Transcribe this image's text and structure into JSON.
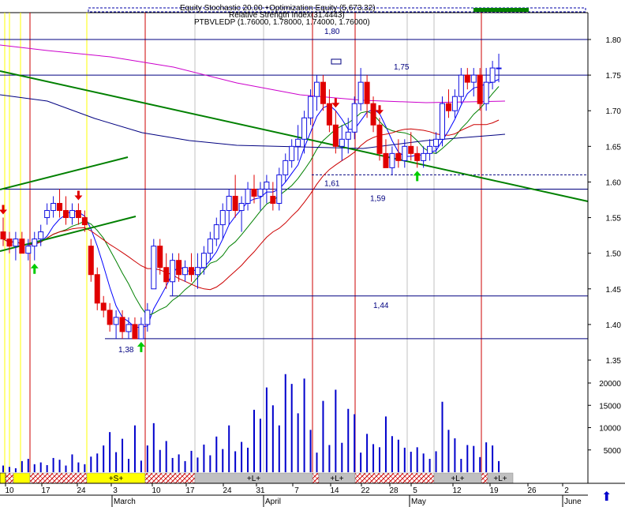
{
  "header": {
    "line1": "Equity Stochastic 20.00 +Optimization Equity (5,673.32)",
    "line2": "Relative Strength Index(31.4443)",
    "line3": "PTBVLEDP (1.76000, 1.78000, 1.74000, 1.76000)"
  },
  "colors": {
    "up_candle": "#1010e0",
    "down_candle": "#e00000",
    "volume": "#0000cc",
    "trendline": "#008000",
    "ma_fast": "#0000ff",
    "ma_mid": "#008000",
    "ma_slow": "#cc0000",
    "ma_long": "#cc00cc",
    "ma_navy": "#000080",
    "marker_line": "#cc0000",
    "band_yellow": "#ffff00",
    "band_gray": "#c0c0c0",
    "band_hatch": "#cc0000"
  },
  "chart_data": {
    "type": "candlestick",
    "price_axis": {
      "min": 1.35,
      "max": 1.8,
      "ticks": [
        "1.80",
        "1.75",
        "1.70",
        "1.65",
        "1.60",
        "1.55",
        "1.50",
        "1.45",
        "1.40",
        "1.35"
      ]
    },
    "volume_axis": {
      "ticks": [
        "20000",
        "15000",
        "10000",
        "5000"
      ]
    },
    "x_ticks": [
      "10",
      "17",
      "24",
      "3",
      "10",
      "17",
      "24",
      "31",
      "7",
      "14",
      "22",
      "28",
      "5",
      "12",
      "19",
      "26",
      "2"
    ],
    "month_labels": [
      "March",
      "April",
      "May",
      "June"
    ],
    "horizontal_levels": [
      {
        "label": "1,80",
        "value": 1.8
      },
      {
        "label": "1,75",
        "value": 1.75
      },
      {
        "label": "1,61",
        "value": 1.61
      },
      {
        "label": "1,59",
        "value": 1.59
      },
      {
        "label": "1,44",
        "value": 1.44
      },
      {
        "label": "1,38",
        "value": 1.38
      }
    ],
    "bands": [
      {
        "label": "",
        "color": "yellow"
      },
      {
        "label": "+S+",
        "color": "yellow"
      },
      {
        "label": "+L+",
        "color": "gray"
      },
      {
        "label": "+L+",
        "color": "gray"
      },
      {
        "label": "+L+",
        "color": "gray"
      },
      {
        "label": "+L+",
        "color": "gray"
      }
    ],
    "candles": [
      {
        "o": 1.53,
        "h": 1.55,
        "l": 1.51,
        "c": 1.52
      },
      {
        "o": 1.52,
        "h": 1.53,
        "l": 1.5,
        "c": 1.51
      },
      {
        "o": 1.51,
        "h": 1.53,
        "l": 1.49,
        "c": 1.52
      },
      {
        "o": 1.52,
        "h": 1.53,
        "l": 1.5,
        "c": 1.5
      },
      {
        "o": 1.5,
        "h": 1.52,
        "l": 1.49,
        "c": 1.51
      },
      {
        "o": 1.51,
        "h": 1.53,
        "l": 1.49,
        "c": 1.52
      },
      {
        "o": 1.52,
        "h": 1.54,
        "l": 1.51,
        "c": 1.53
      },
      {
        "o": 1.55,
        "h": 1.57,
        "l": 1.54,
        "c": 1.56
      },
      {
        "o": 1.56,
        "h": 1.58,
        "l": 1.55,
        "c": 1.57
      },
      {
        "o": 1.57,
        "h": 1.59,
        "l": 1.55,
        "c": 1.56
      },
      {
        "o": 1.56,
        "h": 1.58,
        "l": 1.54,
        "c": 1.55
      },
      {
        "o": 1.55,
        "h": 1.57,
        "l": 1.54,
        "c": 1.56
      },
      {
        "o": 1.56,
        "h": 1.57,
        "l": 1.54,
        "c": 1.55
      },
      {
        "o": 1.55,
        "h": 1.56,
        "l": 1.53,
        "c": 1.54
      },
      {
        "o": 1.51,
        "h": 1.52,
        "l": 1.46,
        "c": 1.47
      },
      {
        "o": 1.47,
        "h": 1.48,
        "l": 1.42,
        "c": 1.43
      },
      {
        "o": 1.43,
        "h": 1.44,
        "l": 1.41,
        "c": 1.42
      },
      {
        "o": 1.42,
        "h": 1.43,
        "l": 1.39,
        "c": 1.4
      },
      {
        "o": 1.4,
        "h": 1.42,
        "l": 1.38,
        "c": 1.41
      },
      {
        "o": 1.41,
        "h": 1.42,
        "l": 1.38,
        "c": 1.39
      },
      {
        "o": 1.39,
        "h": 1.41,
        "l": 1.38,
        "c": 1.4
      },
      {
        "o": 1.4,
        "h": 1.41,
        "l": 1.38,
        "c": 1.38
      },
      {
        "o": 1.38,
        "h": 1.41,
        "l": 1.38,
        "c": 1.4
      },
      {
        "o": 1.4,
        "h": 1.43,
        "l": 1.39,
        "c": 1.42
      },
      {
        "o": 1.45,
        "h": 1.52,
        "l": 1.45,
        "c": 1.51
      },
      {
        "o": 1.51,
        "h": 1.52,
        "l": 1.47,
        "c": 1.48
      },
      {
        "o": 1.48,
        "h": 1.5,
        "l": 1.45,
        "c": 1.46
      },
      {
        "o": 1.46,
        "h": 1.5,
        "l": 1.44,
        "c": 1.49
      },
      {
        "o": 1.49,
        "h": 1.5,
        "l": 1.46,
        "c": 1.47
      },
      {
        "o": 1.47,
        "h": 1.49,
        "l": 1.46,
        "c": 1.48
      },
      {
        "o": 1.48,
        "h": 1.5,
        "l": 1.46,
        "c": 1.47
      },
      {
        "o": 1.47,
        "h": 1.5,
        "l": 1.45,
        "c": 1.48
      },
      {
        "o": 1.48,
        "h": 1.51,
        "l": 1.47,
        "c": 1.5
      },
      {
        "o": 1.5,
        "h": 1.53,
        "l": 1.49,
        "c": 1.52
      },
      {
        "o": 1.52,
        "h": 1.55,
        "l": 1.51,
        "c": 1.54
      },
      {
        "o": 1.54,
        "h": 1.57,
        "l": 1.52,
        "c": 1.56
      },
      {
        "o": 1.56,
        "h": 1.59,
        "l": 1.54,
        "c": 1.58
      },
      {
        "o": 1.58,
        "h": 1.61,
        "l": 1.55,
        "c": 1.56
      },
      {
        "o": 1.56,
        "h": 1.58,
        "l": 1.53,
        "c": 1.57
      },
      {
        "o": 1.57,
        "h": 1.6,
        "l": 1.56,
        "c": 1.59
      },
      {
        "o": 1.59,
        "h": 1.61,
        "l": 1.57,
        "c": 1.58
      },
      {
        "o": 1.58,
        "h": 1.6,
        "l": 1.56,
        "c": 1.59
      },
      {
        "o": 1.59,
        "h": 1.61,
        "l": 1.57,
        "c": 1.6
      },
      {
        "o": 1.58,
        "h": 1.6,
        "l": 1.56,
        "c": 1.57
      },
      {
        "o": 1.57,
        "h": 1.62,
        "l": 1.56,
        "c": 1.61
      },
      {
        "o": 1.61,
        "h": 1.64,
        "l": 1.6,
        "c": 1.63
      },
      {
        "o": 1.63,
        "h": 1.66,
        "l": 1.62,
        "c": 1.65
      },
      {
        "o": 1.65,
        "h": 1.68,
        "l": 1.63,
        "c": 1.66
      },
      {
        "o": 1.66,
        "h": 1.7,
        "l": 1.64,
        "c": 1.69
      },
      {
        "o": 1.69,
        "h": 1.73,
        "l": 1.68,
        "c": 1.72
      },
      {
        "o": 1.72,
        "h": 1.75,
        "l": 1.7,
        "c": 1.74
      },
      {
        "o": 1.74,
        "h": 1.75,
        "l": 1.7,
        "c": 1.71
      },
      {
        "o": 1.71,
        "h": 1.73,
        "l": 1.67,
        "c": 1.68
      },
      {
        "o": 1.68,
        "h": 1.7,
        "l": 1.64,
        "c": 1.65
      },
      {
        "o": 1.65,
        "h": 1.68,
        "l": 1.63,
        "c": 1.66
      },
      {
        "o": 1.66,
        "h": 1.69,
        "l": 1.64,
        "c": 1.67
      },
      {
        "o": 1.67,
        "h": 1.72,
        "l": 1.66,
        "c": 1.71
      },
      {
        "o": 1.71,
        "h": 1.76,
        "l": 1.7,
        "c": 1.74
      },
      {
        "o": 1.74,
        "h": 1.75,
        "l": 1.69,
        "c": 1.71
      },
      {
        "o": 1.71,
        "h": 1.72,
        "l": 1.67,
        "c": 1.68
      },
      {
        "o": 1.68,
        "h": 1.69,
        "l": 1.63,
        "c": 1.64
      },
      {
        "o": 1.64,
        "h": 1.66,
        "l": 1.62,
        "c": 1.62
      },
      {
        "o": 1.62,
        "h": 1.65,
        "l": 1.61,
        "c": 1.64
      },
      {
        "o": 1.64,
        "h": 1.66,
        "l": 1.62,
        "c": 1.63
      },
      {
        "o": 1.63,
        "h": 1.66,
        "l": 1.62,
        "c": 1.65
      },
      {
        "o": 1.65,
        "h": 1.67,
        "l": 1.63,
        "c": 1.64
      },
      {
        "o": 1.64,
        "h": 1.65,
        "l": 1.62,
        "c": 1.63
      },
      {
        "o": 1.63,
        "h": 1.65,
        "l": 1.62,
        "c": 1.64
      },
      {
        "o": 1.64,
        "h": 1.66,
        "l": 1.63,
        "c": 1.65
      },
      {
        "o": 1.65,
        "h": 1.67,
        "l": 1.64,
        "c": 1.66
      },
      {
        "o": 1.66,
        "h": 1.72,
        "l": 1.65,
        "c": 1.71
      },
      {
        "o": 1.71,
        "h": 1.73,
        "l": 1.69,
        "c": 1.7
      },
      {
        "o": 1.7,
        "h": 1.73,
        "l": 1.69,
        "c": 1.72
      },
      {
        "o": 1.72,
        "h": 1.76,
        "l": 1.71,
        "c": 1.75
      },
      {
        "o": 1.75,
        "h": 1.76,
        "l": 1.73,
        "c": 1.74
      },
      {
        "o": 1.74,
        "h": 1.76,
        "l": 1.72,
        "c": 1.75
      },
      {
        "o": 1.75,
        "h": 1.76,
        "l": 1.7,
        "c": 1.71
      },
      {
        "o": 1.71,
        "h": 1.76,
        "l": 1.7,
        "c": 1.74
      },
      {
        "o": 1.74,
        "h": 1.77,
        "l": 1.73,
        "c": 1.76
      },
      {
        "o": 1.76,
        "h": 1.78,
        "l": 1.74,
        "c": 1.76
      }
    ],
    "volume": [
      1500,
      1200,
      900,
      2500,
      3000,
      1800,
      2200,
      1600,
      3200,
      2800,
      1500,
      4000,
      2200,
      1800,
      3500,
      4200,
      6000,
      9000,
      4500,
      7500,
      3000,
      10500,
      2600,
      6000,
      11000,
      5000,
      7000,
      3200,
      4000,
      2500,
      4800,
      3300,
      6200,
      3800,
      8000,
      5200,
      10500,
      4700,
      6800,
      5500,
      14000,
      12000,
      19000,
      15000,
      10500,
      22000,
      19800,
      13200,
      21000,
      9500,
      4400,
      16000,
      6100,
      18500,
      6600,
      14200,
      13000,
      4400,
      8600,
      6300,
      5600,
      12500,
      8100,
      7300,
      5500,
      4600,
      5600,
      4200,
      3000,
      4700,
      15800,
      9500,
      7600,
      3000,
      6100,
      5900,
      3400,
      6700,
      6000,
      2500
    ],
    "signals": [
      {
        "type": "sell",
        "index": 0
      },
      {
        "type": "buy",
        "index": 5
      },
      {
        "type": "sell",
        "index": 12
      },
      {
        "type": "buy",
        "index": 22
      },
      {
        "type": "sell",
        "index": 53
      },
      {
        "type": "sell",
        "index": 60
      },
      {
        "type": "buy",
        "index": 66
      }
    ]
  }
}
